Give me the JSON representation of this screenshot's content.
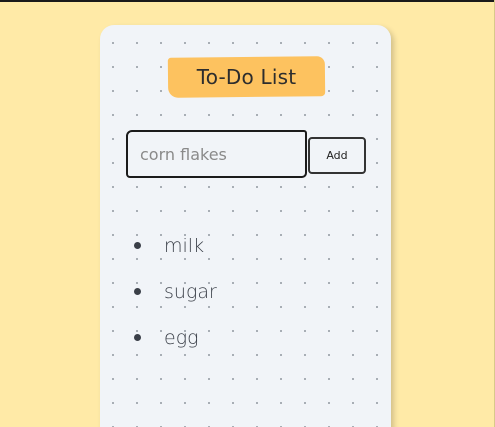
{
  "app": {
    "title": "To-Do List"
  },
  "input": {
    "value": "corn flakes",
    "placeholder": ""
  },
  "add_button": {
    "label": "Add"
  },
  "todos": [
    {
      "label": "milk"
    },
    {
      "label": "sugar"
    },
    {
      "label": "egg"
    }
  ],
  "colors": {
    "background": "#FFEAA7",
    "card": "#F1F4F8",
    "title_highlight": "#FDC25F",
    "text": "#3a3f48"
  }
}
